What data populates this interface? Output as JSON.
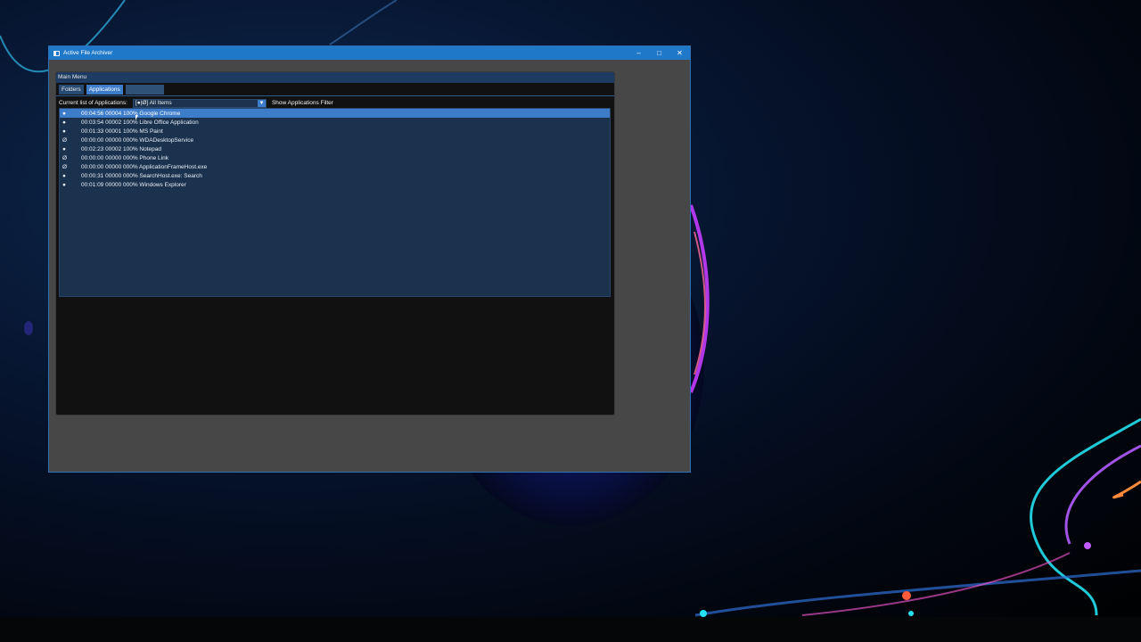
{
  "window": {
    "title": "Active File Archiver",
    "controls": {
      "minimize": "–",
      "maximize": "□",
      "close": "✕"
    }
  },
  "panel": {
    "header": "Main Menu",
    "tabs": [
      {
        "label": "Folders",
        "active": false
      },
      {
        "label": "Applications",
        "active": true
      },
      {
        "label": "",
        "active": false
      }
    ],
    "filter": {
      "label": "Current list of Applications:",
      "combo_value": "[●|Ø] All Items",
      "combo_arrow": "▼",
      "button_label": "Show Applications Filter"
    },
    "rows": [
      {
        "status": "●",
        "text": "00:04:56 00004 100% Google Chrome",
        "selected": true
      },
      {
        "status": "●",
        "text": "00:03:54 00002 100% Libre Office Application",
        "selected": false
      },
      {
        "status": "●",
        "text": "00:01:33 00001 100% MS Paint",
        "selected": false
      },
      {
        "status": "Ø",
        "text": "00:00:00 00000 000% WDADesktopService",
        "selected": false
      },
      {
        "status": "●",
        "text": "00:02:23 00002 100% Notepad",
        "selected": false
      },
      {
        "status": "Ø",
        "text": "00:00:00 00000 000% Phone Link",
        "selected": false
      },
      {
        "status": "Ø",
        "text": "00:00:00 00000 000% ApplicationFrameHost.exe",
        "selected": false
      },
      {
        "status": "●",
        "text": "00:00:31 00000 000% SearchHost.exe: Search",
        "selected": false
      },
      {
        "status": "●",
        "text": "00:01:09 00000 000% Windows Explorer",
        "selected": false
      }
    ]
  },
  "colors": {
    "titlebar": "#1f78c8",
    "selection": "#3d7cc9",
    "list_background": "#1b324f"
  }
}
